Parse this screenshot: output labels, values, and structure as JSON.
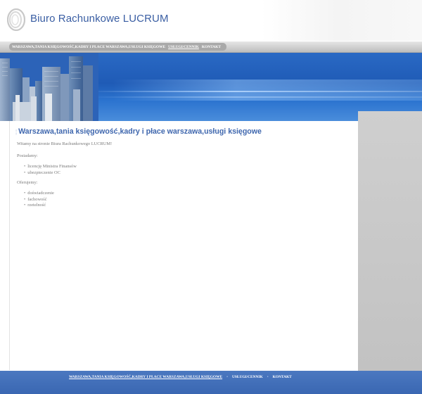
{
  "header": {
    "site_title": "Biuro Rachunkowe LUCRUM"
  },
  "top_nav": {
    "items": [
      "WARSZAWA,TANIA KSIĘGOWOŚĆ,KADRY I PŁACE WARSZAWA,USŁUGI KSIĘGOWE",
      "USŁUGI/CENNIK",
      "KONTAKT"
    ]
  },
  "content": {
    "title_bullet": "¦",
    "title": "Warszawa,tania księgowość,kadry i płace warszawa,usługi księgowe",
    "intro": "Witamy na stronie Biura Rachunkowego LUCRUM!",
    "section1_label": "Posiadamy:",
    "section1_items": [
      "licencję Ministra Finansów",
      "ubezpieczenie OC"
    ],
    "section2_label": "Oferujemy:",
    "section2_items": [
      "doświadczenie",
      "fachowość",
      "rzetelność"
    ]
  },
  "footer_nav": {
    "items": [
      "WARSZAWA,TANIA KSIĘGOWOŚĆ,KADRY I PŁACE WARSZAWA,USŁUGI KSIĘGOWE",
      "USŁUGI/CENNIK",
      "KONTAKT"
    ],
    "separator": "•"
  },
  "colors": {
    "title_blue": "#3a5ea3",
    "banner_blue": "#2a69c4",
    "footer_blue": "#4070bb",
    "side_gray": "#c8c8c8"
  },
  "icons": {
    "logo": "concentric-rings-logo"
  }
}
